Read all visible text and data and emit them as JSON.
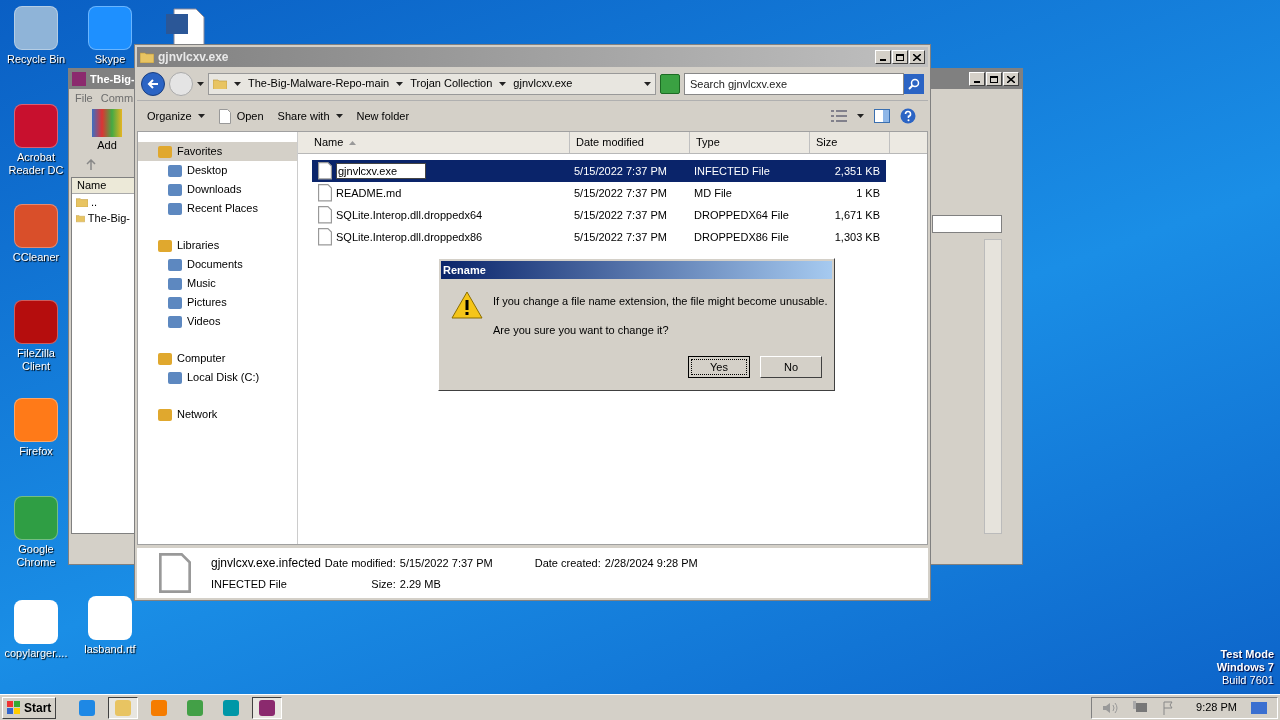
{
  "desktop_icons": [
    {
      "label": "Recycle Bin"
    },
    {
      "label": "Skype"
    },
    {
      "label": "Acrobat Reader DC"
    },
    {
      "label": "CCleaner"
    },
    {
      "label": "FileZilla Client"
    },
    {
      "label": "Firefox"
    },
    {
      "label": "Google Chrome"
    },
    {
      "label": "copylarger...."
    },
    {
      "label": "lasband.rtf"
    }
  ],
  "archiver_window": {
    "title": "The-Big-",
    "menu": [
      "File",
      "Comm"
    ],
    "tool": "Add",
    "column": "Name",
    "items": [
      "..",
      "The-Big-"
    ]
  },
  "explorer": {
    "title": "gjnvlcxv.exe",
    "breadcrumb": [
      "The-Big-Malware-Repo-main",
      "Trojan Collection",
      "gjnvlcxv.exe"
    ],
    "search_placeholder": "Search gjnvlcxv.exe",
    "toolbar": [
      {
        "label": "Organize",
        "kind": "menu"
      },
      {
        "label": "Open",
        "kind": "document"
      },
      {
        "label": "Share with",
        "kind": "menu"
      },
      {
        "label": "New folder",
        "kind": "plain"
      }
    ],
    "nav": [
      {
        "label": "Favorites",
        "selected": true,
        "children": [
          {
            "label": "Desktop",
            "selected": false
          },
          {
            "label": "Downloads",
            "selected": false
          },
          {
            "label": "Recent Places",
            "selected": false
          }
        ]
      },
      {
        "label": "Libraries",
        "selected": false,
        "children": [
          {
            "label": "Documents",
            "selected": false
          },
          {
            "label": "Music",
            "selected": false
          },
          {
            "label": "Pictures",
            "selected": false
          },
          {
            "label": "Videos",
            "selected": false
          }
        ]
      },
      {
        "label": "Computer",
        "selected": false,
        "children": [
          {
            "label": "Local Disk (C:)",
            "selected": false
          }
        ]
      },
      {
        "label": "Network",
        "selected": false
      }
    ],
    "columns": [
      "Name",
      "Date modified",
      "Type",
      "Size"
    ],
    "rows": [
      {
        "name": "gjnvlcxv.exe",
        "date": "5/15/2022 7:37 PM",
        "type": "INFECTED File",
        "size": "2,351 KB",
        "selected": true,
        "editing": true
      },
      {
        "name": "README.md",
        "date": "5/15/2022 7:37 PM",
        "type": "MD File",
        "size": "1 KB",
        "selected": false,
        "editing": false
      },
      {
        "name": "SQLite.Interop.dll.droppedx64",
        "date": "5/15/2022 7:37 PM",
        "type": "DROPPEDX64 File",
        "size": "1,671 KB",
        "selected": false,
        "editing": false
      },
      {
        "name": "SQLite.Interop.dll.droppedx86",
        "date": "5/15/2022 7:37 PM",
        "type": "DROPPEDX86 File",
        "size": "1,303 KB",
        "selected": false,
        "editing": false
      }
    ],
    "details": {
      "name": "gjnvlcxv.exe.infected",
      "type": "INFECTED File",
      "modified_label": "Date modified:",
      "modified": "5/15/2022 7:37 PM",
      "size_label": "Size:",
      "size": "2.29 MB",
      "created_label": "Date created:",
      "created": "2/28/2024 9:28 PM"
    }
  },
  "dialog": {
    "title": "Rename",
    "message": "If you change a file name extension, the file might become unusable.",
    "question": "Are you sure you want to change it?",
    "buttons": [
      {
        "label": "Yes",
        "default": true
      },
      {
        "label": "No",
        "default": false
      }
    ]
  },
  "os_notice": {
    "mode": "Test Mode",
    "edition": "Windows 7",
    "build": "Build 7601"
  },
  "taskbar": {
    "start": "Start",
    "items": [
      {
        "selected": false
      },
      {
        "selected": true
      },
      {
        "selected": false
      },
      {
        "selected": false
      },
      {
        "selected": false
      },
      {
        "selected": true
      }
    ],
    "clock": "9:28 PM"
  }
}
